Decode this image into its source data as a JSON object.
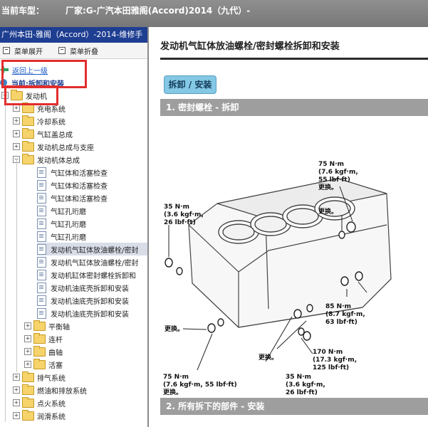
{
  "topbar": {
    "label": "当前车型：",
    "value": "厂家:G-广汽本田雅阁(Accord)2014（九代）-"
  },
  "left": {
    "title": "广州本田-雅阁（Accord）-2014-维修手",
    "menu": {
      "expand": "菜单展开",
      "collapse": "菜单折叠"
    },
    "tree": {
      "back": "返回上一级",
      "current": "当前:拆卸和安装",
      "root": "发动机",
      "items": [
        "充电系统",
        "冷却系统",
        "气缸盖总成",
        "发动机总成与支座",
        "发动机体总成"
      ],
      "docs": [
        "气缸体和活塞检查",
        "气缸体和活塞检查",
        "气缸体和活塞检查",
        "气缸孔珩磨",
        "气缸孔珩磨",
        "气缸孔珩磨",
        "发动机气缸体放油螺栓/密封",
        "发动机气缸体放油螺栓/密封",
        "发动机缸体密封螺栓拆卸和",
        "发动机油底壳拆卸和安装",
        "发动机油底壳拆卸和安装",
        "发动机油底壳拆卸和安装"
      ],
      "subfolders": [
        "平衡轴",
        "连杆",
        "曲轴",
        "活塞"
      ],
      "bottom": [
        "排气系统",
        "燃油和排放系统",
        "点火系统",
        "润滑系统"
      ]
    }
  },
  "right": {
    "title": "发动机气缸体放油螺栓/密封螺栓拆卸和安装",
    "button": "拆卸 / 安装",
    "section1": "1. 密封螺栓 - 拆卸",
    "section2": "2. 所有拆下的部件 - 安装",
    "figure": {
      "label_a": {
        "line1": "75 N·m",
        "line2": "(7.6 kgf·m,",
        "line3": "55 lbf·ft)",
        "line4": "更换。"
      },
      "label_b": {
        "line1": "35 N·m",
        "line2": "(3.6 kgf·m,",
        "line3": "26 lbf·ft)"
      },
      "label_c": "更换。",
      "label_d": {
        "line1": "85 N·m",
        "line2": "(8.7 kgf·m,",
        "line3": "63 lbf·ft)"
      },
      "label_e": "更换。",
      "label_f": "更换。",
      "label_g": {
        "line1": "170 N·m",
        "line2": "(17.3 kgf·m,",
        "line3": "125 lbf·ft)"
      },
      "label_h": {
        "line1": "75 N·m",
        "line2": "(7.6 kgf·m, 55 lbf·ft)",
        "line3": "更换。"
      },
      "label_i": {
        "line1": "35 N·m",
        "line2": "(3.6 kgf·m,",
        "line3": "26 lbf·ft)"
      }
    }
  }
}
